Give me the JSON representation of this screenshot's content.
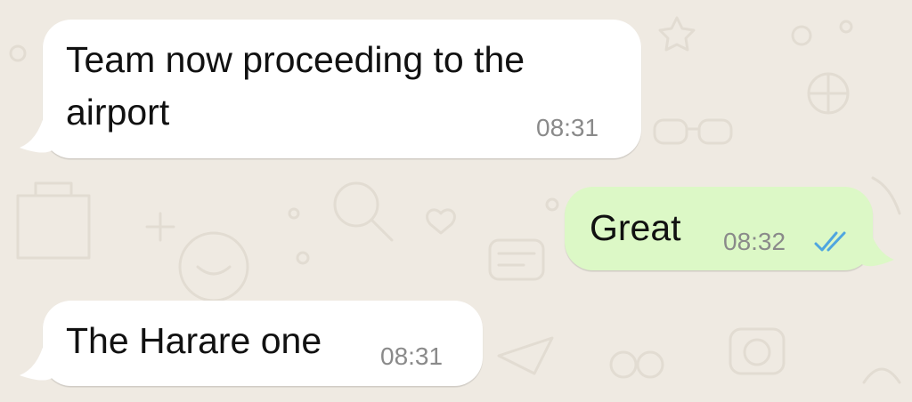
{
  "colors": {
    "wallpaper": "#efeae2",
    "incoming_bubble": "#ffffff",
    "outgoing_bubble": "#dcf8c6",
    "timestamp": "#8a8a8a",
    "read_ticks": "#4fa6e0"
  },
  "messages": [
    {
      "direction": "incoming",
      "text": "Team now proceeding to the\nairport",
      "time": "08:31"
    },
    {
      "direction": "outgoing",
      "text": "Great",
      "time": "08:32",
      "status_icon": "double-check-read-icon"
    },
    {
      "direction": "incoming",
      "text": "The Harare one",
      "time": "08:31"
    }
  ]
}
